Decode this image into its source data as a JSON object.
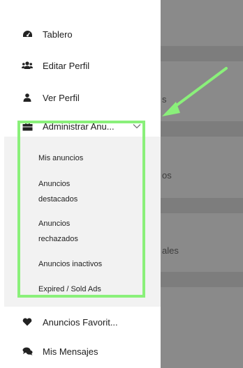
{
  "backdrop": {
    "fragments": [
      "s",
      "os",
      "ales"
    ]
  },
  "menu": {
    "items": [
      {
        "label": "Tablero",
        "icon": "dashboard-icon"
      },
      {
        "label": "Editar Perfil",
        "icon": "users-icon"
      },
      {
        "label": "Ver Perfil",
        "icon": "user-icon"
      },
      {
        "label": "Administrar Anu...",
        "icon": "briefcase-icon",
        "expanded": true
      },
      {
        "label": "Anuncios Favorit...",
        "icon": "heart-icon"
      },
      {
        "label": "Mis Mensajes",
        "icon": "chat-icon"
      }
    ],
    "submenu": [
      {
        "lines": [
          "Mis anuncios"
        ]
      },
      {
        "lines": [
          "Anuncios",
          "destacados"
        ]
      },
      {
        "lines": [
          "Anuncios",
          "rechazados"
        ]
      },
      {
        "lines": [
          "Anuncios inactivos"
        ]
      },
      {
        "lines": [
          "Expired / Sold Ads"
        ]
      }
    ]
  },
  "colors": {
    "highlight": "#8af07a",
    "backdrop": "#8a8a8a",
    "submenu_bg": "#f2f2f2"
  }
}
